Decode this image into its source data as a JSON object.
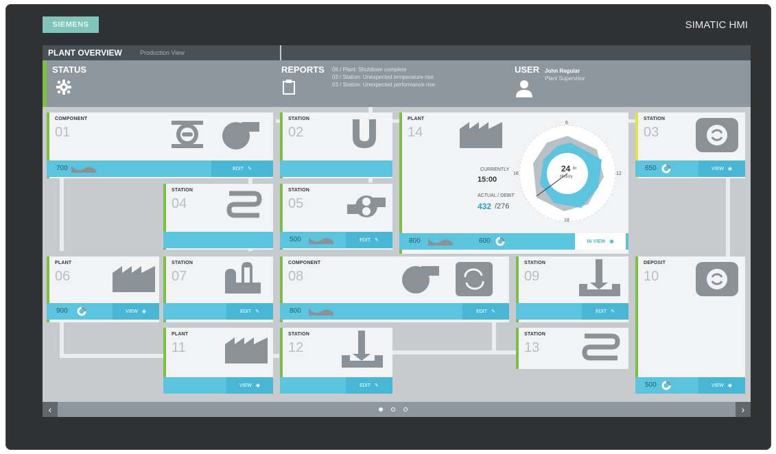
{
  "brand_logo": "SIEMENS",
  "brand_product": "SIMATIC HMI",
  "titlebar": {
    "title": "PLANT OVERVIEW",
    "subtitle": "Production View"
  },
  "status": {
    "label": "STATUS",
    "icon": "gear-icon"
  },
  "reports": {
    "label": "REPORTS",
    "icon": "clipboard-icon",
    "lines": [
      "06 / Plant: Shutdown complete",
      "03 / Station: Unexpected temperature rise",
      "03 / Station: Unexpected performance rise"
    ]
  },
  "user": {
    "label": "USER",
    "icon": "user-icon",
    "name": "John Regular",
    "role": "Plant Supervisor"
  },
  "tiles": [
    {
      "type": "COMPONENT",
      "number": "01",
      "bar_value": "700",
      "button": "EDIT"
    },
    {
      "type": "STATION",
      "number": "02"
    },
    {
      "type": "PLANT",
      "number": "14",
      "bar_value": "800",
      "bar_value2": "600",
      "button": "IN VIEW"
    },
    {
      "type": "STATION",
      "number": "03",
      "bar_value": "650",
      "button": "VIEW"
    },
    {
      "type": "STATION",
      "number": "04"
    },
    {
      "type": "STATION",
      "number": "05",
      "bar_value": "500",
      "button": "EDIT"
    },
    {
      "type": "PLANT",
      "number": "06",
      "bar_value": "900",
      "button": "VIEW"
    },
    {
      "type": "STATION",
      "number": "07",
      "button": "EDIT"
    },
    {
      "type": "COMPONENT",
      "number": "08",
      "bar_value": "800",
      "button": "EDIT"
    },
    {
      "type": "STATION",
      "number": "09",
      "button": "EDIT"
    },
    {
      "type": "DEPOSIT",
      "number": "10",
      "bar_value": "500",
      "button": "VIEW"
    },
    {
      "type": "PLANT",
      "number": "11",
      "button": "VIEW"
    },
    {
      "type": "STATION",
      "number": "12",
      "button": "EDIT"
    },
    {
      "type": "STATION",
      "number": "13"
    }
  ],
  "plant14": {
    "currently_label": "CURRENTLY",
    "currently_value": "15:00",
    "actual_label": "ACTUAL / DEBIT",
    "actual_value": "432",
    "debit_value": "/276",
    "gauge_center": "24",
    "gauge_unit": "hr",
    "gauge_sub": "History",
    "tick_top": "6",
    "tick_right": "12",
    "tick_bottom": "18",
    "tick_left": "18"
  },
  "pagination": {
    "pages": 3,
    "current": 1
  },
  "colors": {
    "accent": "#5bc4de",
    "button": "#47b7d5",
    "green": "#7bc043",
    "panel": "#8e979d"
  }
}
